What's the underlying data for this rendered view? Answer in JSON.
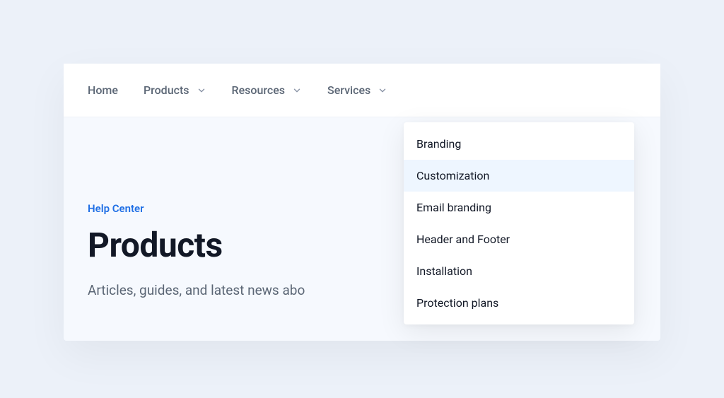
{
  "nav": {
    "items": [
      {
        "label": "Home",
        "hasDropdown": false
      },
      {
        "label": "Products",
        "hasDropdown": true
      },
      {
        "label": "Resources",
        "hasDropdown": true
      },
      {
        "label": "Services",
        "hasDropdown": true
      }
    ]
  },
  "breadcrumb": "Help Center",
  "title": "Products",
  "subtitle": "Articles, guides, and latest news abo",
  "dropdown": {
    "items": [
      "Branding",
      "Customization",
      "Email branding",
      "Header and Footer",
      "Installation",
      "Protection plans"
    ],
    "highlightedIndex": 1
  }
}
